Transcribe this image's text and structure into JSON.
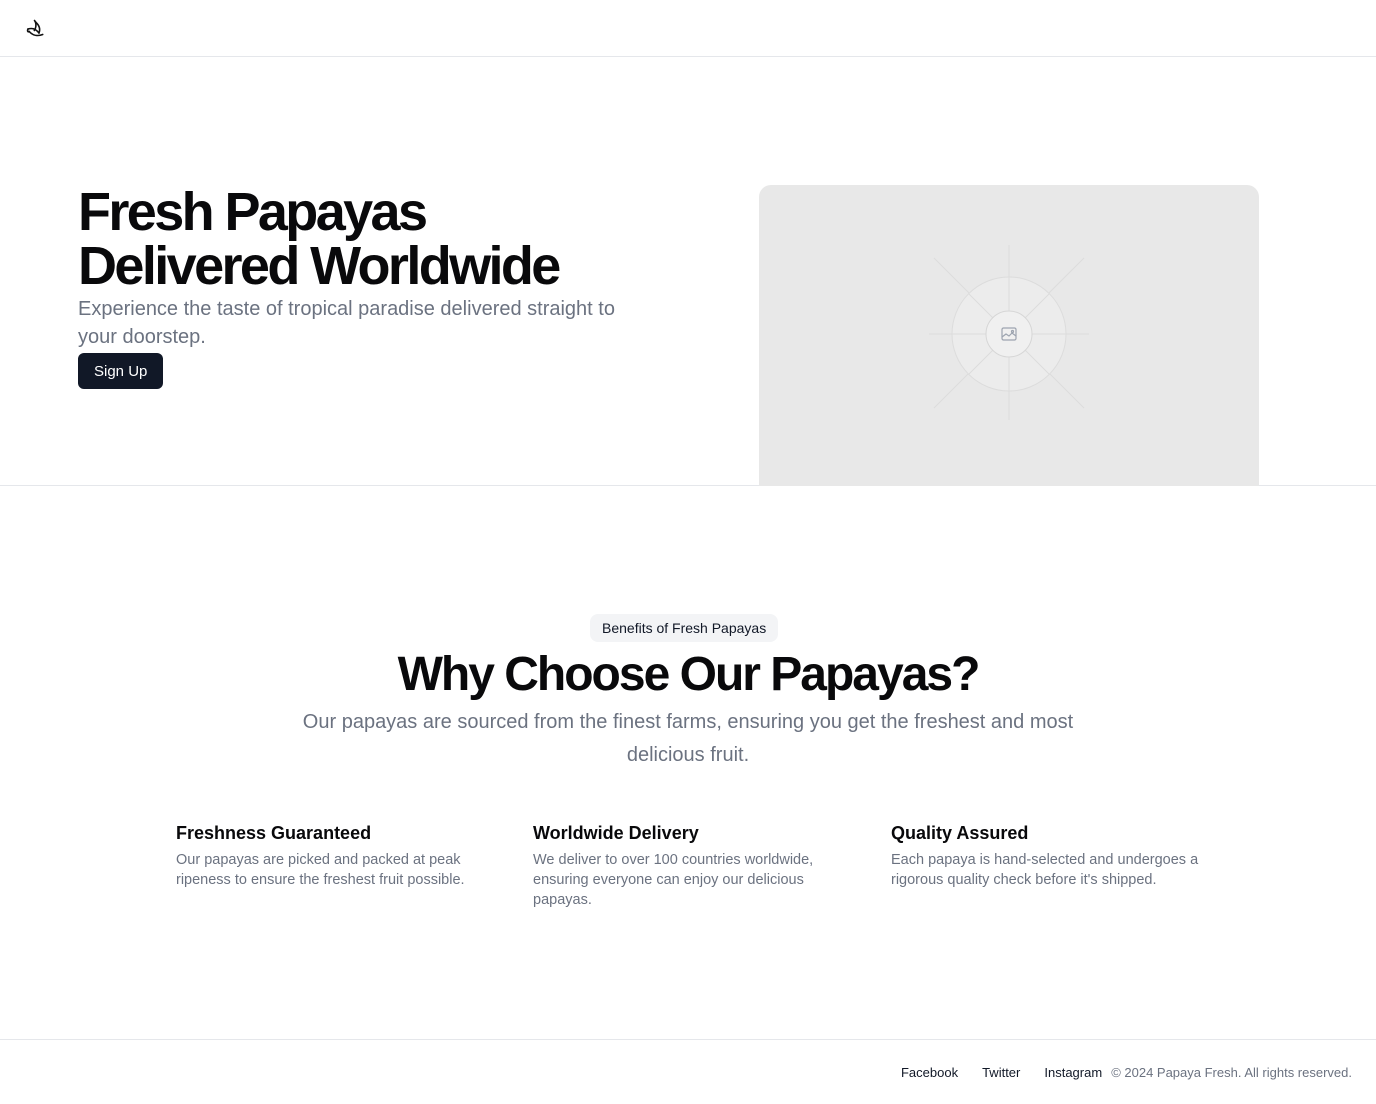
{
  "header": {
    "logo_icon": "banana-logo-icon"
  },
  "hero": {
    "title": "Fresh Papayas Delivered Worldwide",
    "subtitle": "Experience the taste of tropical paradise delivered straight to your doorstep.",
    "cta_label": "Sign Up",
    "image_icon": "image-placeholder-icon"
  },
  "features_section": {
    "badge": "Benefits of Fresh Papayas",
    "title": "Why Choose Our Papayas?",
    "subtitle": "Our papayas are sourced from the finest farms, ensuring you get the freshest and most delicious fruit.",
    "items": [
      {
        "title": "Freshness Guaranteed",
        "text": "Our papayas are picked and packed at peak ripeness to ensure the freshest fruit possible."
      },
      {
        "title": "Worldwide Delivery",
        "text": "We deliver to over 100 countries worldwide, ensuring everyone can enjoy our delicious papayas."
      },
      {
        "title": "Quality Assured",
        "text": "Each papaya is hand-selected and undergoes a rigorous quality check before it's shipped."
      }
    ]
  },
  "footer": {
    "links": [
      "Facebook",
      "Twitter",
      "Instagram"
    ],
    "copyright": "© 2024 Papaya Fresh. All rights reserved."
  },
  "colors": {
    "primary_button": "#111827",
    "muted_text": "#6b7280",
    "border": "#e5e7eb",
    "placeholder_bg": "#e8e8e8"
  }
}
